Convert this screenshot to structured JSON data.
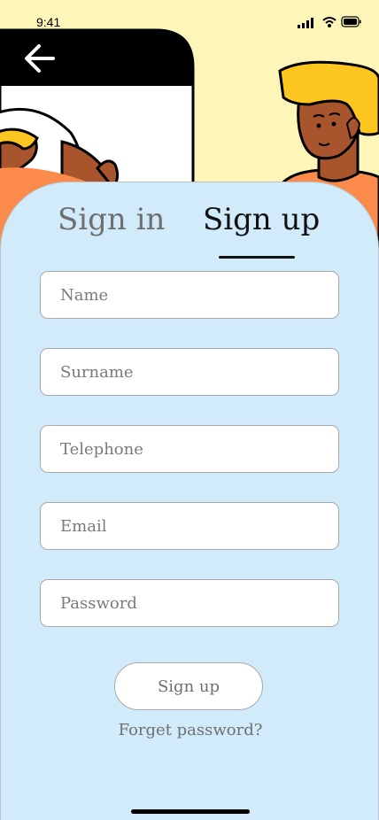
{
  "status_bar": {
    "time": "9:41",
    "signal_icon": "cellular-signal-icon",
    "wifi_icon": "wifi-icon",
    "battery_icon": "battery-icon"
  },
  "header": {
    "back_icon": "arrow-left-icon"
  },
  "tabs": [
    {
      "label": "Sign in",
      "active": false
    },
    {
      "label": "Sign up",
      "active": true
    }
  ],
  "form": {
    "fields": [
      {
        "placeholder": "Name",
        "value": ""
      },
      {
        "placeholder": "Surname",
        "value": ""
      },
      {
        "placeholder": "Telephone",
        "value": ""
      },
      {
        "placeholder": "Email",
        "value": ""
      },
      {
        "placeholder": "Password",
        "value": ""
      }
    ],
    "submit_label": "Sign up",
    "forgot_label": "Forget password?"
  },
  "colors": {
    "background": "#fdf6b8",
    "sheet": "#d2ebfb",
    "accent_orange": "#fb8a4b",
    "hair_yellow": "#fcc51f",
    "skin": "#a8552d"
  }
}
